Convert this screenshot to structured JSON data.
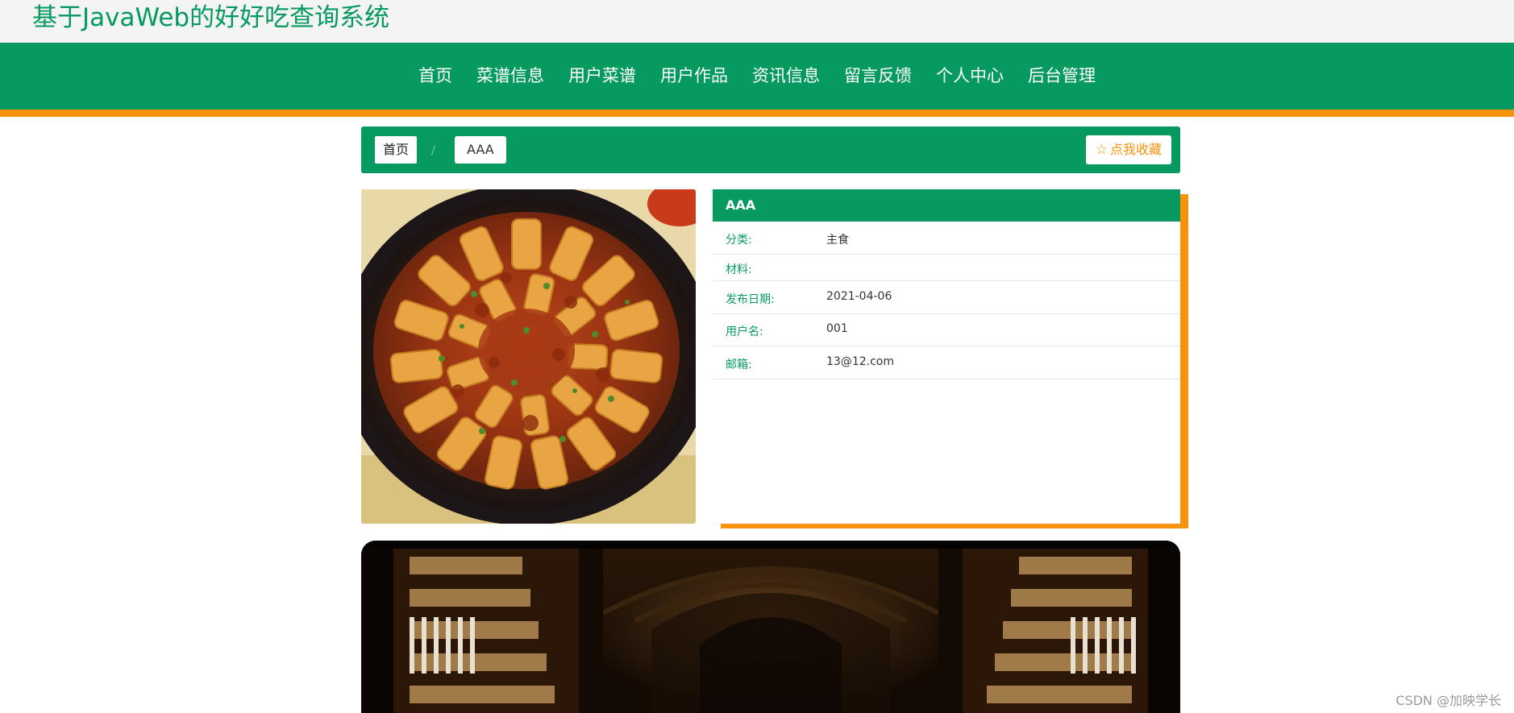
{
  "site": {
    "title": "基于JavaWeb的好好吃查询系统"
  },
  "nav": {
    "items": [
      {
        "label": "首页"
      },
      {
        "label": "菜谱信息"
      },
      {
        "label": "用户菜谱"
      },
      {
        "label": "用户作品"
      },
      {
        "label": "资讯信息"
      },
      {
        "label": "留言反馈"
      },
      {
        "label": "个人中心"
      },
      {
        "label": "后台管理"
      }
    ]
  },
  "breadcrumb": {
    "home": "首页",
    "separator": "/",
    "current": "AAA"
  },
  "favorite": {
    "label": "点我收藏",
    "icon": "star-outline-icon"
  },
  "detail": {
    "title": "AAA",
    "fields": [
      {
        "label": "分类:",
        "value": "主食"
      },
      {
        "label": "材料:",
        "value": ""
      },
      {
        "label": "发布日期:",
        "value": "2021-04-06"
      },
      {
        "label": "用户名:",
        "value": "001"
      },
      {
        "label": "邮箱:",
        "value": "13@12.com"
      }
    ]
  },
  "watermark": "CSDN @加映学长",
  "colors": {
    "primary": "#069a61",
    "accent": "#f7920f",
    "topbar": "#f4f4f4"
  }
}
